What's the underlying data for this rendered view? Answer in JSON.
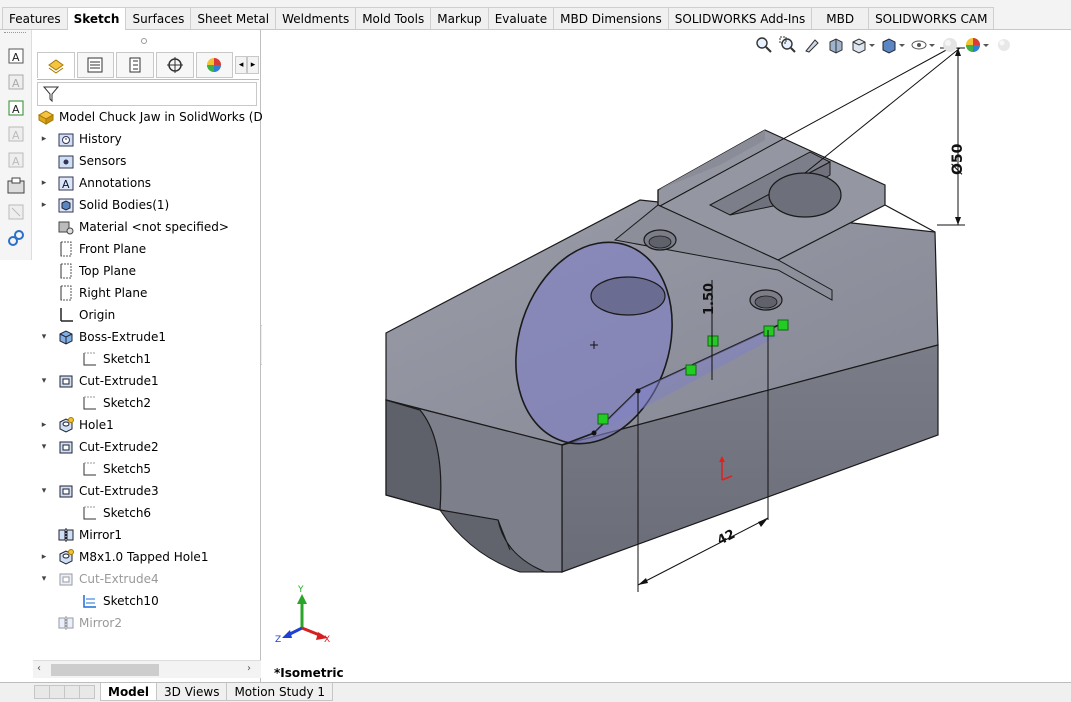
{
  "command_tabs": [
    "Features",
    "Sketch",
    "Surfaces",
    "Sheet Metal",
    "Weldments",
    "Mold Tools",
    "Markup",
    "Evaluate",
    "MBD Dimensions",
    "SOLIDWORKS Add-Ins",
    "MBD",
    "SOLIDWORKS CAM"
  ],
  "active_tab": "Sketch",
  "tree": {
    "root": "Model Chuck Jaw in SolidWorks  (Defa",
    "items": [
      {
        "label": "History",
        "icon": "history-folder-icon"
      },
      {
        "label": "Sensors",
        "icon": "sensors-icon"
      },
      {
        "label": "Annotations",
        "icon": "annotations-icon"
      },
      {
        "label": "Solid Bodies(1)",
        "icon": "solid-bodies-icon"
      },
      {
        "label": "Material <not specified>",
        "icon": "material-icon"
      },
      {
        "label": "Front Plane",
        "icon": "plane-icon"
      },
      {
        "label": "Top Plane",
        "icon": "plane-icon"
      },
      {
        "label": "Right Plane",
        "icon": "plane-icon"
      },
      {
        "label": "Origin",
        "icon": "origin-icon"
      },
      {
        "label": "Boss-Extrude1",
        "icon": "boss-extrude-icon"
      },
      {
        "label": "Sketch1",
        "icon": "sketch-icon"
      },
      {
        "label": "Cut-Extrude1",
        "icon": "cut-extrude-icon"
      },
      {
        "label": "Sketch2",
        "icon": "sketch-icon"
      },
      {
        "label": "Hole1",
        "icon": "hole-icon"
      },
      {
        "label": "Cut-Extrude2",
        "icon": "cut-extrude-icon"
      },
      {
        "label": "Sketch5",
        "icon": "sketch-icon"
      },
      {
        "label": "Cut-Extrude3",
        "icon": "cut-extrude-icon"
      },
      {
        "label": "Sketch6",
        "icon": "sketch-icon"
      },
      {
        "label": "Mirror1",
        "icon": "mirror-icon"
      },
      {
        "label": "M8x1.0 Tapped Hole1",
        "icon": "tapped-hole-icon"
      },
      {
        "label": "Cut-Extrude4",
        "icon": "cut-extrude-icon"
      },
      {
        "label": "Sketch10",
        "icon": "sketch-active-icon"
      },
      {
        "label": "Mirror2",
        "icon": "mirror-icon"
      }
    ]
  },
  "view": {
    "label": "*Isometric"
  },
  "dimensions": {
    "d50": "Ø50",
    "d150": "1.50",
    "d42": "42"
  },
  "triad": {
    "x": "X",
    "y": "Y",
    "z": "Z"
  },
  "bottom_tabs": [
    "Model",
    "3D Views",
    "Motion Study 1"
  ],
  "colors": {
    "model_face": "#8e909d",
    "model_dark": "#6b6d78",
    "sketch_fill": "#7f7fc0",
    "relation_green": "#22cc22",
    "accent": "#1e6fd9"
  }
}
